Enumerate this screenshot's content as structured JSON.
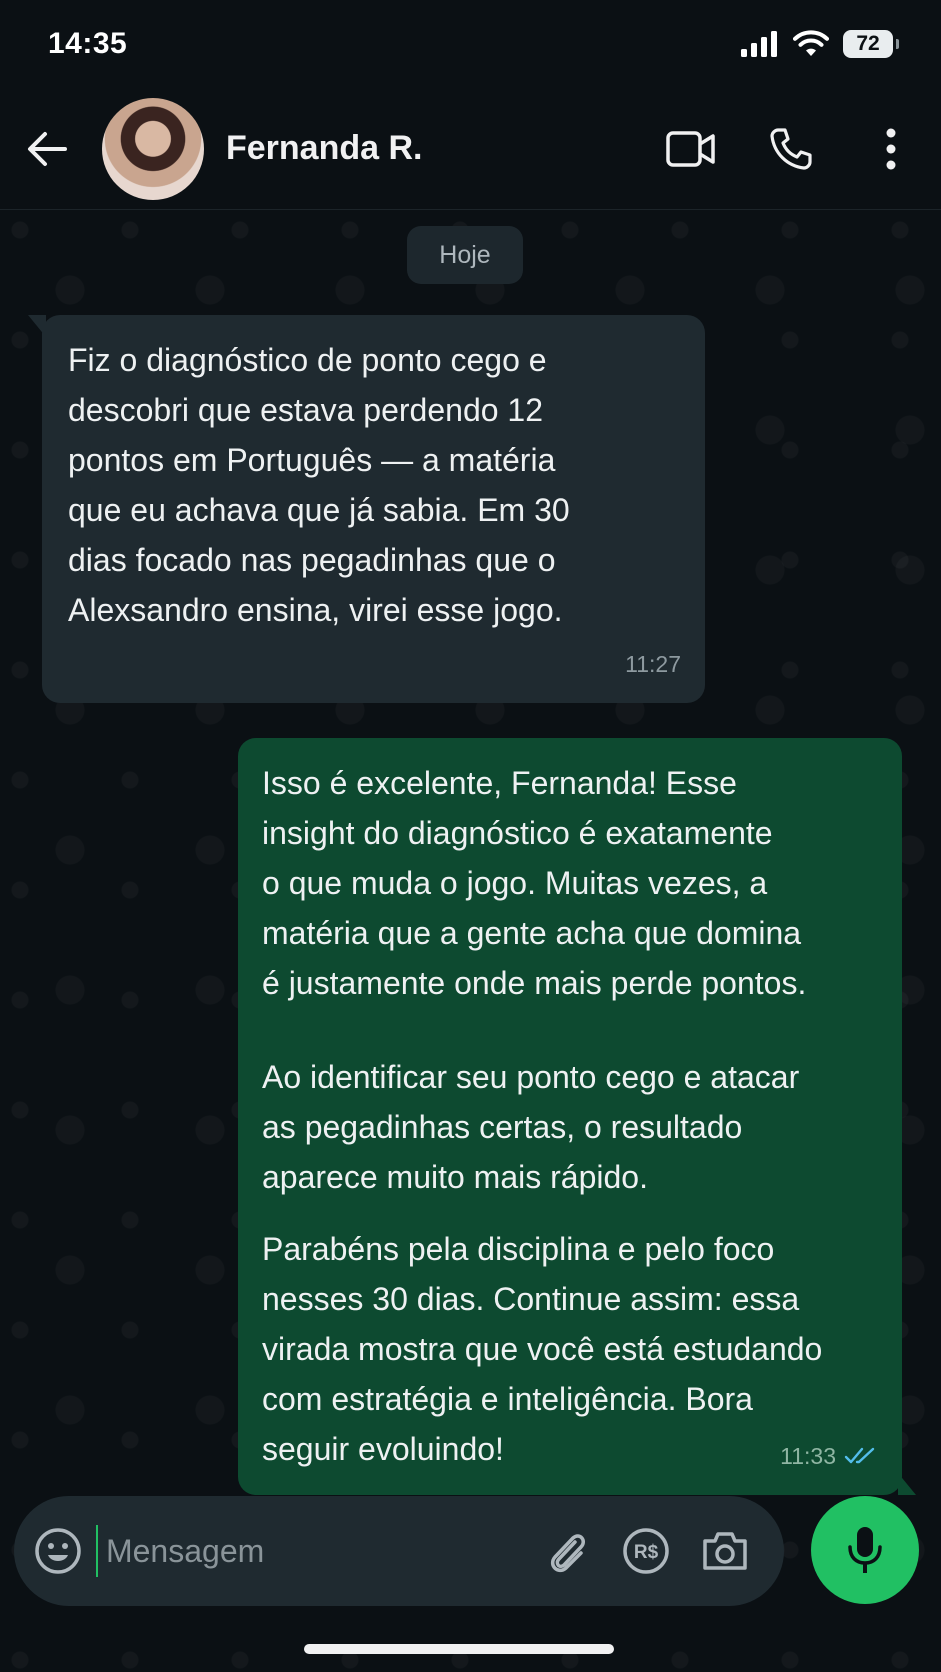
{
  "status_bar": {
    "time": "14:35",
    "battery": "72"
  },
  "header": {
    "contact_name": "Fernanda R."
  },
  "chat": {
    "date_label": "Hoje",
    "messages": [
      {
        "direction": "incoming",
        "text": "Fiz o diagnóstico de ponto cego e\ndescobri que estava perdendo 12\npontos em Português — a matéria\nque eu achava que já sabia. Em 30\ndias focado nas pegadinhas que o\nAlexsandro ensina, virei esse jogo.",
        "time": "11:27"
      },
      {
        "direction": "outgoing",
        "paragraphs": [
          "Isso é excelente, Fernanda! Esse\ninsight do diagnóstico é exatamente\no que muda o jogo. Muitas vezes, a\nmatéria que a gente acha que domina\né justamente onde mais perde pontos.",
          "Ao identificar seu ponto cego e atacar\nas pegadinhas certas, o resultado\naparece muito mais rápido.",
          "Parabéns pela disciplina e pelo foco\nnesses 30 dias. Continue assim: essa\nvirada mostra que você está estudando\ncom estratégia e inteligência. Bora\nseguir evoluindo!"
        ],
        "time": "11:33",
        "status": "read"
      }
    ]
  },
  "composer": {
    "placeholder": "Mensagem",
    "value": ""
  },
  "icons": {
    "back": "arrow-left-icon",
    "video": "video-call-icon",
    "call": "phone-icon",
    "menu": "more-vertical-icon",
    "emoji": "emoji-icon",
    "attach": "paperclip-icon",
    "payment": "payment-icon",
    "camera": "camera-icon",
    "mic": "microphone-icon"
  },
  "colors": {
    "background": "#0b1014",
    "incoming_bubble": "#1f2a30",
    "outgoing_bubble": "#0d4a30",
    "accent": "#21c063",
    "read_ticks": "#53bdeb"
  }
}
